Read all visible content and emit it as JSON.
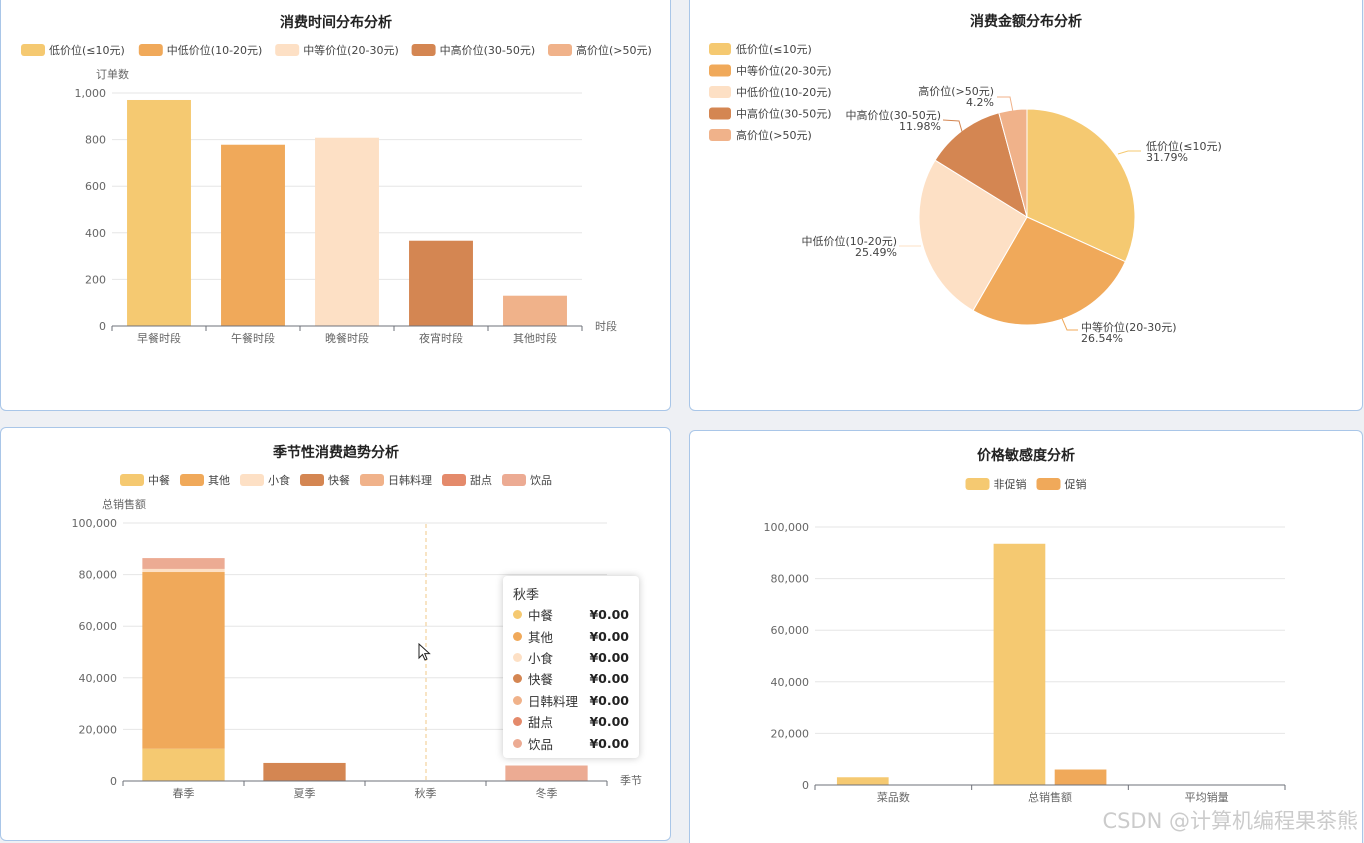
{
  "watermark": "CSDN @计算机编程果茶熊",
  "colors": [
    "#f5c971",
    "#f0a95a",
    "#fde0c5",
    "#d48652",
    "#f0b28a",
    "#e48a6b",
    "#ecab93"
  ],
  "charts": [
    {
      "type": "bar",
      "title": "消费时间分布分析",
      "legend": [
        "低价位(≤10元)",
        "中低价位(10-20元)",
        "中等价位(20-30元)",
        "中高价位(30-50元)",
        "高价位(>50元)"
      ],
      "ylabel": "订单数",
      "xlabel": "时段",
      "categories": [
        "早餐时段",
        "午餐时段",
        "晚餐时段",
        "夜宵时段",
        "其他时段"
      ],
      "values": [
        970,
        778,
        808,
        366,
        130
      ],
      "ylim": [
        0,
        1000
      ],
      "yticks": [
        "0",
        "200",
        "400",
        "600",
        "800",
        "1,000"
      ]
    },
    {
      "type": "pie",
      "title": "消费金额分布分析",
      "legend": [
        "低价位(≤10元)",
        "中等价位(20-30元)",
        "中低价位(10-20元)",
        "中高价位(30-50元)",
        "高价位(>50元)"
      ],
      "slices": [
        {
          "label": "低价位(≤10元)",
          "pct_label": "31.79%",
          "value": 31.79
        },
        {
          "label": "中等价位(20-30元)",
          "pct_label": "26.54%",
          "value": 26.54
        },
        {
          "label": "中低价位(10-20元)",
          "pct_label": "25.49%",
          "value": 25.49
        },
        {
          "label": "中高价位(30-50元)",
          "pct_label": "11.98%",
          "value": 11.98
        },
        {
          "label": "高价位(>50元)",
          "pct_label": "4.2%",
          "value": 4.2
        }
      ]
    },
    {
      "type": "bar",
      "stacked": true,
      "title": "季节性消费趋势分析",
      "legend": [
        "中餐",
        "其他",
        "小食",
        "快餐",
        "日韩料理",
        "甜点",
        "饮品"
      ],
      "ylabel": "总销售额",
      "xlabel": "季节",
      "categories": [
        "春季",
        "夏季",
        "秋季",
        "冬季"
      ],
      "series": [
        {
          "name": "中餐",
          "values": [
            12500,
            0,
            0,
            0
          ]
        },
        {
          "name": "其他",
          "values": [
            68500,
            0,
            0,
            0
          ]
        },
        {
          "name": "小食",
          "values": [
            1200,
            0,
            0,
            0
          ]
        },
        {
          "name": "快餐",
          "values": [
            0,
            7000,
            0,
            0
          ]
        },
        {
          "name": "日韩料理",
          "values": [
            0,
            0,
            0,
            0
          ]
        },
        {
          "name": "甜点",
          "values": [
            0,
            0,
            0,
            0
          ]
        },
        {
          "name": "饮品",
          "values": [
            4200,
            0,
            0,
            6000
          ]
        }
      ],
      "ylim": [
        0,
        100000
      ],
      "yticks": [
        "0",
        "20,000",
        "40,000",
        "60,000",
        "80,000",
        "100,000"
      ],
      "tooltip": {
        "title": "秋季",
        "rows": [
          {
            "name": "中餐",
            "value": "¥0.00"
          },
          {
            "name": "其他",
            "value": "¥0.00"
          },
          {
            "name": "小食",
            "value": "¥0.00"
          },
          {
            "name": "快餐",
            "value": "¥0.00"
          },
          {
            "name": "日韩料理",
            "value": "¥0.00"
          },
          {
            "name": "甜点",
            "value": "¥0.00"
          },
          {
            "name": "饮品",
            "value": "¥0.00"
          }
        ]
      }
    },
    {
      "type": "bar",
      "title": "价格敏感度分析",
      "legend": [
        "非促销",
        "促销"
      ],
      "categories": [
        "菜品数",
        "总销售额",
        "平均销量"
      ],
      "series": [
        {
          "name": "非促销",
          "values": [
            3000,
            93500,
            0
          ]
        },
        {
          "name": "促销",
          "values": [
            0,
            6000,
            0
          ]
        }
      ],
      "ylim": [
        0,
        100000
      ],
      "yticks": [
        "0",
        "20,000",
        "40,000",
        "60,000",
        "80,000",
        "100,000"
      ]
    }
  ]
}
